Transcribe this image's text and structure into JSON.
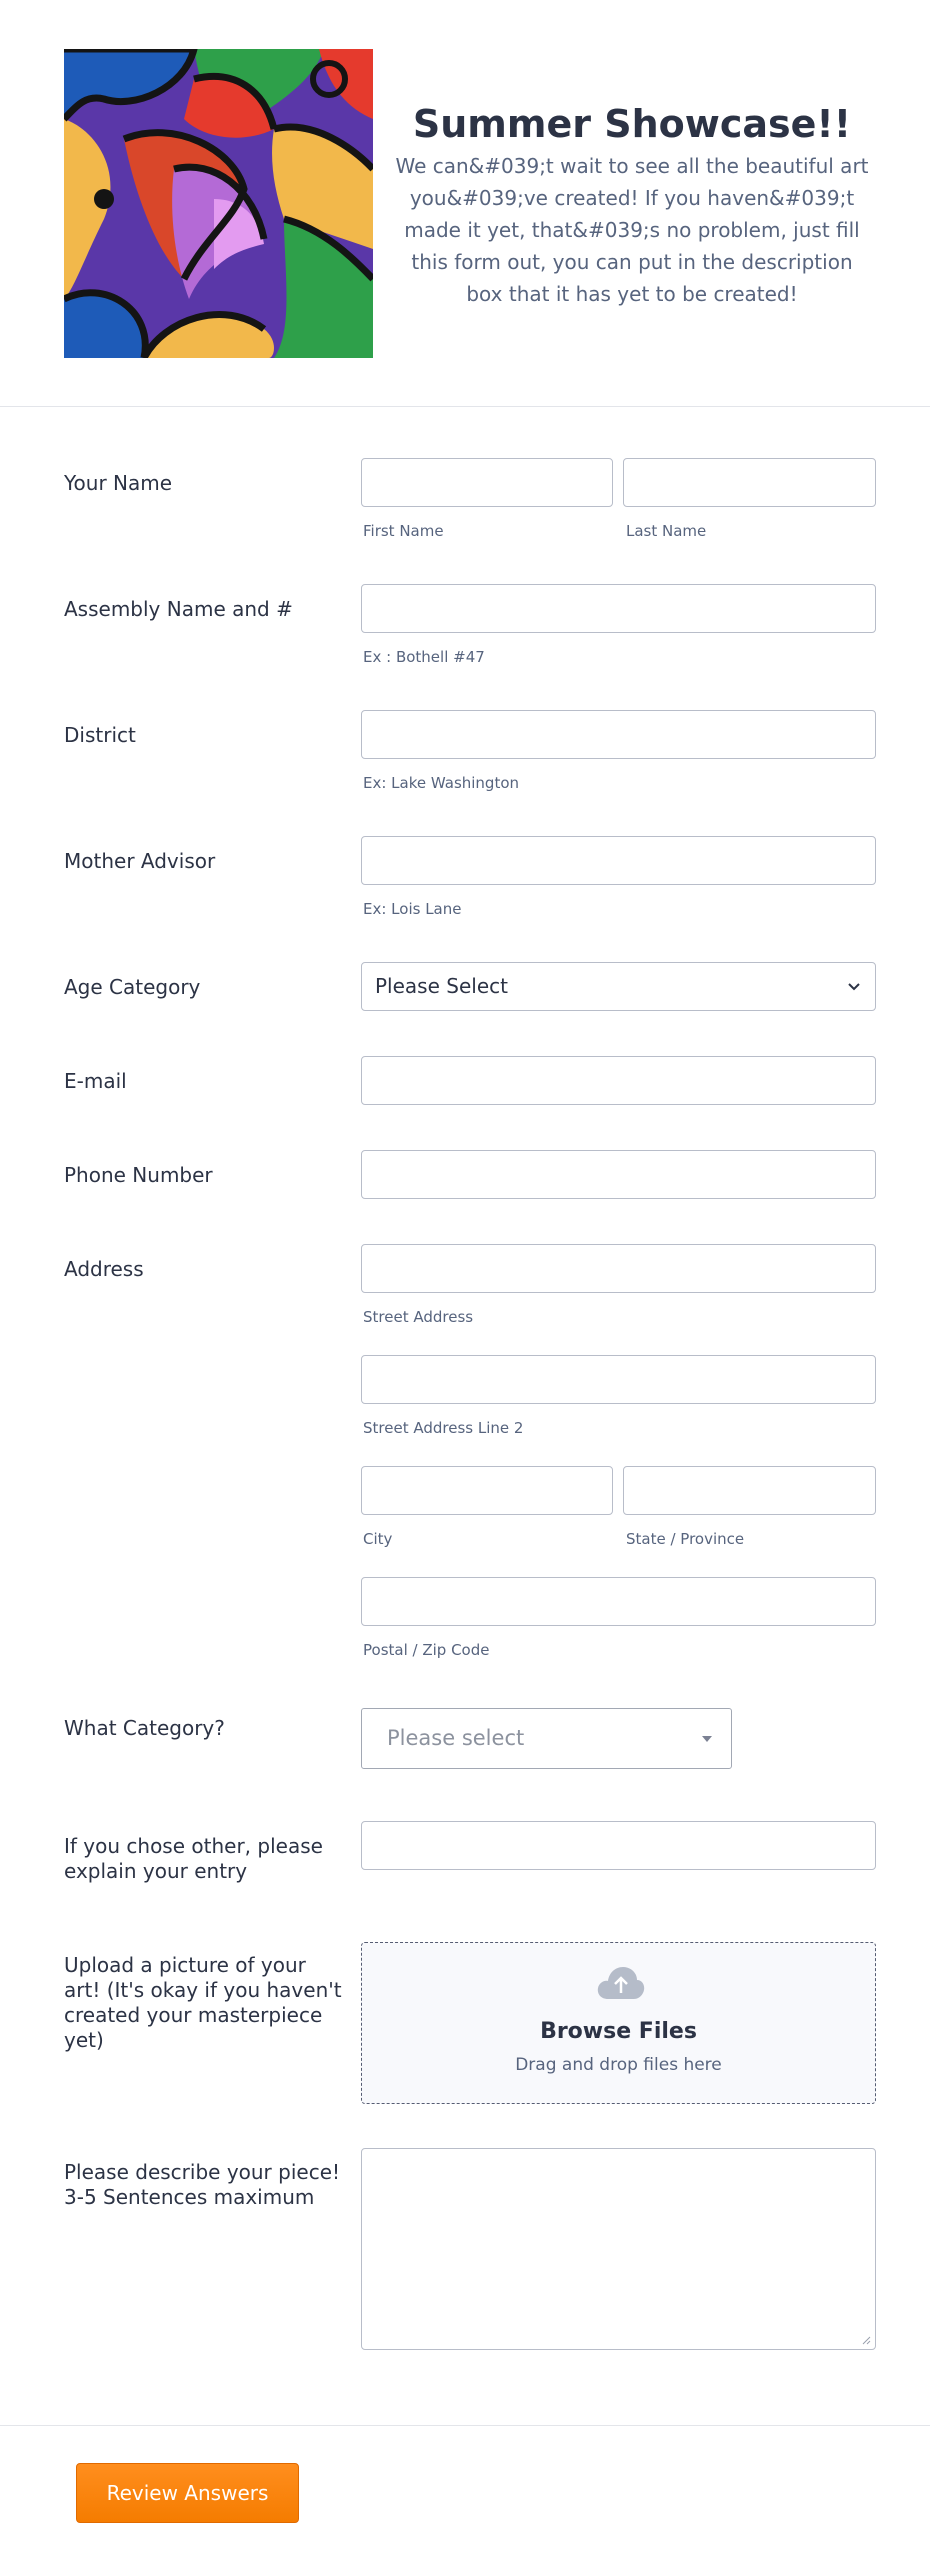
{
  "header": {
    "title": "Summer Showcase!!",
    "description": "We can&#039;t wait to see all the beautiful art you&#039;ve created! If you haven&#039;t made it yet, that&#039;s no problem, just fill this form out, you can put in the description box that it has yet to be created!"
  },
  "fields": {
    "name": {
      "label": "Your Name",
      "first_sublabel": "First Name",
      "last_sublabel": "Last Name"
    },
    "assembly": {
      "label": "Assembly Name and #",
      "sublabel": "Ex : Bothell #47"
    },
    "district": {
      "label": "District",
      "sublabel": "Ex: Lake Washington"
    },
    "advisor": {
      "label": "Mother Advisor",
      "sublabel": "Ex: Lois Lane"
    },
    "age": {
      "label": "Age Category",
      "selected": "Please Select"
    },
    "email": {
      "label": "E-mail"
    },
    "phone": {
      "label": "Phone Number"
    },
    "address": {
      "label": "Address",
      "street_sublabel": "Street Address",
      "street2_sublabel": "Street Address Line 2",
      "city_sublabel": "City",
      "state_sublabel": "State / Province",
      "zip_sublabel": "Postal / Zip Code"
    },
    "category": {
      "label": "What Category?",
      "selected": "Please select"
    },
    "other": {
      "label": "If you chose other, please explain your entry"
    },
    "upload": {
      "label": "Upload a picture of your art! (It's okay if you haven't created your masterpiece yet)",
      "button": "Browse Files",
      "hint": "Drag and drop files here"
    },
    "describe": {
      "label": "Please describe your piece! 3-5 Sentences maximum"
    }
  },
  "footer": {
    "review_label": "Review Answers"
  },
  "colors": {
    "accent": "#f57c00",
    "text": "#2c3345",
    "muted": "#57647e",
    "border": "#b8bdc9"
  }
}
